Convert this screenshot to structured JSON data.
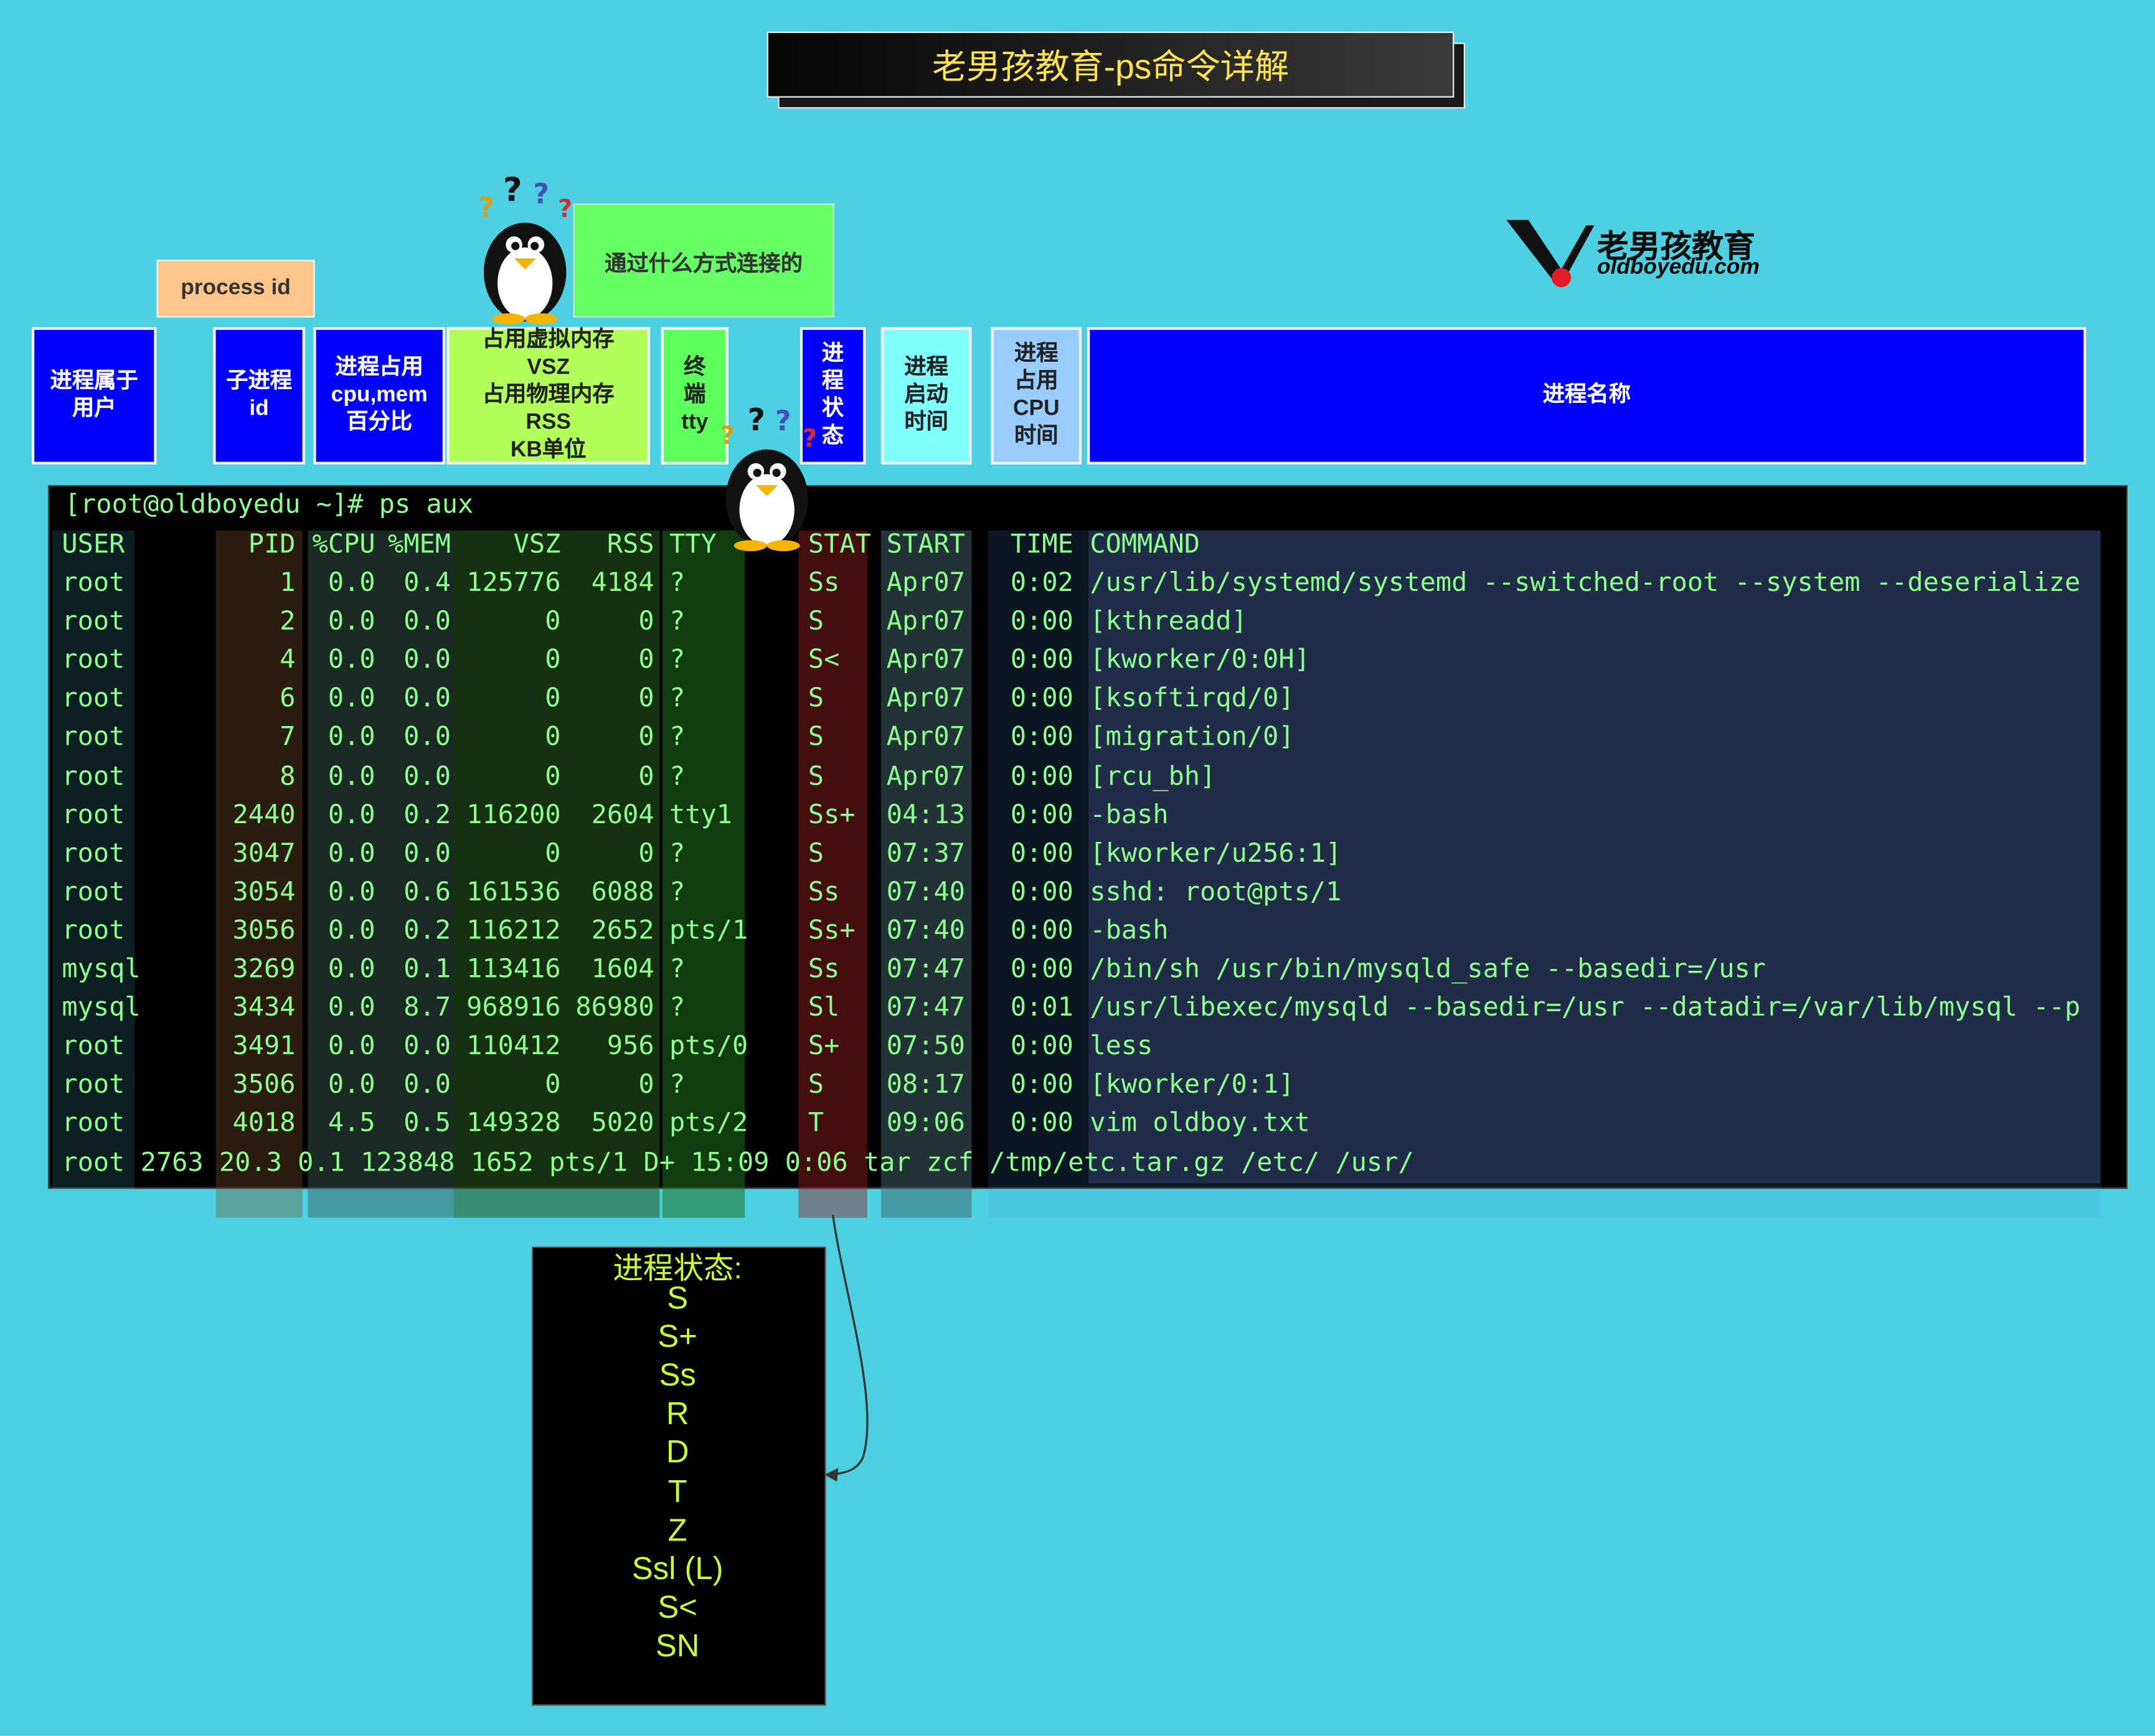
{
  "title": "老男孩教育-ps命令详解",
  "notes": {
    "process_id": "process id",
    "tty_note": "通过什么方式连接的"
  },
  "logo": {
    "name": "老男孩教育",
    "url": "oldboyedu.com"
  },
  "headers": {
    "user": "进程属于\n用户",
    "pid": "子进程\nid",
    "cpu_mem": "进程占用\ncpu,mem\n百分比",
    "vsz_rss": "占用虚拟内存\nVSZ\n占用物理内存\nRSS\nKB单位",
    "tty": "终\n端\ntty",
    "stat": "进\n程\n状\n态",
    "start": "进程\n启动\n时间",
    "time": "进程\n占用\nCPU\n时间",
    "command": "进程名称"
  },
  "terminal": {
    "prompt": "[root@oldboyedu ~]# ps aux",
    "columns": [
      "USER",
      "PID",
      "%CPU",
      "%MEM",
      "VSZ",
      "RSS",
      "TTY",
      "STAT",
      "START",
      "TIME",
      "COMMAND"
    ],
    "rows": [
      [
        "root",
        "1",
        "0.0",
        "0.4",
        "125776",
        "4184",
        "?",
        "Ss",
        "Apr07",
        "0:02",
        "/usr/lib/systemd/systemd --switched-root --system --deserialize"
      ],
      [
        "root",
        "2",
        "0.0",
        "0.0",
        "0",
        "0",
        "?",
        "S",
        "Apr07",
        "0:00",
        "[kthreadd]"
      ],
      [
        "root",
        "4",
        "0.0",
        "0.0",
        "0",
        "0",
        "?",
        "S<",
        "Apr07",
        "0:00",
        "[kworker/0:0H]"
      ],
      [
        "root",
        "6",
        "0.0",
        "0.0",
        "0",
        "0",
        "?",
        "S",
        "Apr07",
        "0:00",
        "[ksoftirqd/0]"
      ],
      [
        "root",
        "7",
        "0.0",
        "0.0",
        "0",
        "0",
        "?",
        "S",
        "Apr07",
        "0:00",
        "[migration/0]"
      ],
      [
        "root",
        "8",
        "0.0",
        "0.0",
        "0",
        "0",
        "?",
        "S",
        "Apr07",
        "0:00",
        "[rcu_bh]"
      ],
      [
        "root",
        "2440",
        "0.0",
        "0.2",
        "116200",
        "2604",
        "tty1",
        "Ss+",
        "04:13",
        "0:00",
        "-bash"
      ],
      [
        "root",
        "3047",
        "0.0",
        "0.0",
        "0",
        "0",
        "?",
        "S",
        "07:37",
        "0:00",
        "[kworker/u256:1]"
      ],
      [
        "root",
        "3054",
        "0.0",
        "0.6",
        "161536",
        "6088",
        "?",
        "Ss",
        "07:40",
        "0:00",
        "sshd: root@pts/1"
      ],
      [
        "root",
        "3056",
        "0.0",
        "0.2",
        "116212",
        "2652",
        "pts/1",
        "Ss+",
        "07:40",
        "0:00",
        "-bash"
      ],
      [
        "mysql",
        "3269",
        "0.0",
        "0.1",
        "113416",
        "1604",
        "?",
        "Ss",
        "07:47",
        "0:00",
        "/bin/sh /usr/bin/mysqld_safe --basedir=/usr"
      ],
      [
        "mysql",
        "3434",
        "0.0",
        "8.7",
        "968916",
        "86980",
        "?",
        "Sl",
        "07:47",
        "0:01",
        "/usr/libexec/mysqld --basedir=/usr --datadir=/var/lib/mysql --p"
      ],
      [
        "root",
        "3491",
        "0.0",
        "0.0",
        "110412",
        "956",
        "pts/0",
        "S+",
        "07:50",
        "0:00",
        "less"
      ],
      [
        "root",
        "3506",
        "0.0",
        "0.0",
        "0",
        "0",
        "?",
        "S",
        "08:17",
        "0:00",
        "[kworker/0:1]"
      ],
      [
        "root",
        "4018",
        "4.5",
        "0.5",
        "149328",
        "5020",
        "pts/2",
        "T",
        "09:06",
        "0:00",
        "vim oldboy.txt"
      ]
    ],
    "last_line": "root 2763 20.3 0.1 123848 1652 pts/1 D+ 15:09 0:06 tar zcf /tmp/etc.tar.gz /etc/ /usr/"
  },
  "status": {
    "title": "进程状态:",
    "items": [
      "S",
      "S+",
      "Ss",
      "R",
      "D",
      "T",
      "Z",
      "Ssl (L)",
      "S<",
      "SN"
    ]
  },
  "colors": {
    "background": "#4dd0e1",
    "term_text": "#8dff8d",
    "status_text": "#c6ff33",
    "title_text": "#ffe34d"
  }
}
